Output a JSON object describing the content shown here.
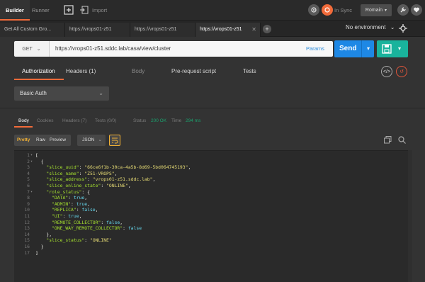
{
  "topbar": {
    "tabs": [
      {
        "label": "Builder",
        "active": true
      },
      {
        "label": "Runner",
        "active": false
      }
    ],
    "import_label": "Import",
    "sync_label": "In Sync",
    "user_label": "Romain"
  },
  "request_tabs": [
    {
      "label": "Get All Custom Gro..."
    },
    {
      "label": "https://vrops01-z51"
    },
    {
      "label": "https://vrops01-z51"
    },
    {
      "label": "https://vrops01-z51"
    }
  ],
  "environment": {
    "label": "No environment"
  },
  "request": {
    "method": "GET",
    "url": "https://vrops01-z51.sddc.lab/casa/view/cluster",
    "params_label": "Params",
    "send_label": "Send"
  },
  "request_subtabs": [
    {
      "label": "Authorization"
    },
    {
      "label": "Headers (1)"
    },
    {
      "label": "Body"
    },
    {
      "label": "Pre-request script"
    },
    {
      "label": "Tests"
    }
  ],
  "auth": {
    "type": "Basic Auth"
  },
  "response": {
    "tabs": [
      {
        "label": "Body"
      },
      {
        "label": "Cookies"
      },
      {
        "label": "Headers (7)"
      },
      {
        "label": "Tests (0/0)"
      }
    ],
    "status_label": "Status",
    "status_value": "200 OK",
    "time_label": "Time",
    "time_value": "294 ms",
    "format_buttons": [
      {
        "label": "Pretty"
      },
      {
        "label": "Raw"
      },
      {
        "label": "Preview"
      }
    ],
    "format_type": "JSON",
    "lines": [
      {
        "n": "1",
        "fold": "▾",
        "parts": [
          [
            "p",
            "["
          ]
        ]
      },
      {
        "n": "2",
        "fold": "▾",
        "parts": [
          [
            "p",
            "  {"
          ]
        ]
      },
      {
        "n": "3",
        "fold": "",
        "parts": [
          [
            "k",
            "    \"slice_uuid\""
          ],
          [
            "p",
            ": "
          ],
          [
            "s",
            "\"66ce6f1b-30ca-4a5b-8d69-5bd064745193\""
          ],
          [
            "p",
            ","
          ]
        ]
      },
      {
        "n": "4",
        "fold": "",
        "parts": [
          [
            "k",
            "    \"slice_name\""
          ],
          [
            "p",
            ": "
          ],
          [
            "s",
            "\"Z51-VROPS\""
          ],
          [
            "p",
            ","
          ]
        ]
      },
      {
        "n": "5",
        "fold": "",
        "parts": [
          [
            "k",
            "    \"slice_address\""
          ],
          [
            "p",
            ": "
          ],
          [
            "s",
            "\"vrops01-z51.sddc.lab\""
          ],
          [
            "p",
            ","
          ]
        ]
      },
      {
        "n": "6",
        "fold": "",
        "parts": [
          [
            "k",
            "    \"slice_online_state\""
          ],
          [
            "p",
            ": "
          ],
          [
            "s",
            "\"ONLINE\""
          ],
          [
            "p",
            ","
          ]
        ]
      },
      {
        "n": "7",
        "fold": "▾",
        "parts": [
          [
            "k",
            "    \"role_status\""
          ],
          [
            "p",
            ": {"
          ]
        ]
      },
      {
        "n": "8",
        "fold": "",
        "parts": [
          [
            "k",
            "      \"DATA\""
          ],
          [
            "p",
            ": "
          ],
          [
            "b",
            "true"
          ],
          [
            "p",
            ","
          ]
        ]
      },
      {
        "n": "9",
        "fold": "",
        "parts": [
          [
            "k",
            "      \"ADMIN\""
          ],
          [
            "p",
            ": "
          ],
          [
            "b",
            "true"
          ],
          [
            "p",
            ","
          ]
        ]
      },
      {
        "n": "10",
        "fold": "",
        "parts": [
          [
            "k",
            "      \"REPLICA\""
          ],
          [
            "p",
            ": "
          ],
          [
            "b",
            "false"
          ],
          [
            "p",
            ","
          ]
        ]
      },
      {
        "n": "11",
        "fold": "",
        "parts": [
          [
            "k",
            "      \"UI\""
          ],
          [
            "p",
            ": "
          ],
          [
            "b",
            "true"
          ],
          [
            "p",
            ","
          ]
        ]
      },
      {
        "n": "12",
        "fold": "",
        "parts": [
          [
            "k",
            "      \"REMOTE_COLLECTOR\""
          ],
          [
            "p",
            ": "
          ],
          [
            "b",
            "false"
          ],
          [
            "p",
            ","
          ]
        ]
      },
      {
        "n": "13",
        "fold": "",
        "parts": [
          [
            "k",
            "      \"ONE_WAY_REMOTE_COLLECTOR\""
          ],
          [
            "p",
            ": "
          ],
          [
            "b",
            "false"
          ]
        ]
      },
      {
        "n": "14",
        "fold": "",
        "parts": [
          [
            "p",
            "    },"
          ]
        ]
      },
      {
        "n": "15",
        "fold": "",
        "parts": [
          [
            "k",
            "    \"slice_status\""
          ],
          [
            "p",
            ": "
          ],
          [
            "s",
            "\"ONLINE\""
          ]
        ]
      },
      {
        "n": "16",
        "fold": "",
        "parts": [
          [
            "p",
            "  }"
          ]
        ]
      },
      {
        "n": "17",
        "fold": "",
        "parts": [
          [
            "p",
            "]"
          ]
        ]
      }
    ]
  },
  "colors": {
    "accent": "#f26b3a",
    "send": "#1e88e5",
    "save": "#19b39c",
    "status_ok": "#1aa36f",
    "json_key": "#a6e22e",
    "json_string": "#e6db74",
    "json_bool": "#66d9ef"
  }
}
